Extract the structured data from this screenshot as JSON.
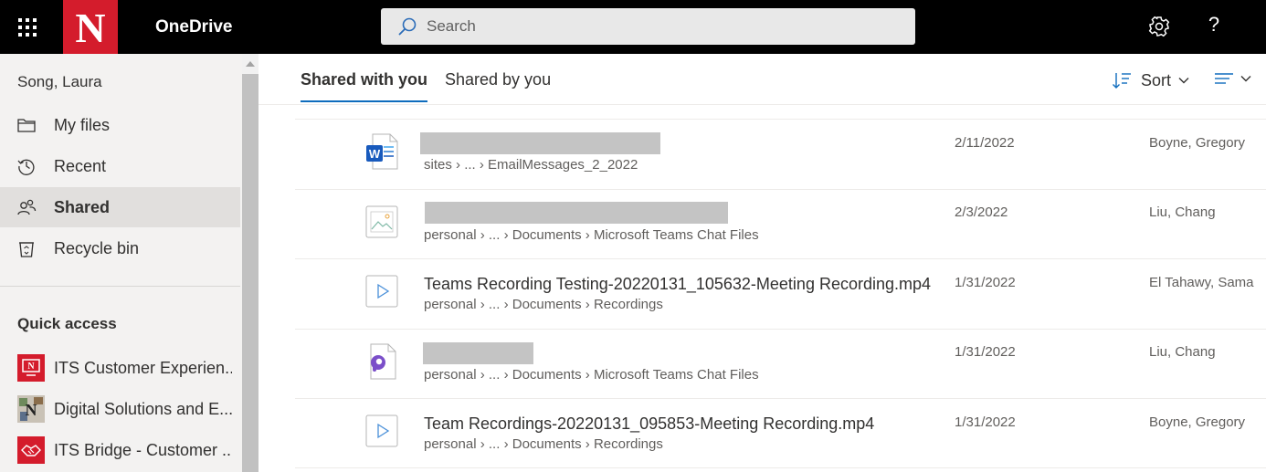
{
  "header": {
    "app_title": "OneDrive",
    "logo_letter": "N",
    "search_placeholder": "Search",
    "help_label": "?"
  },
  "sidebar": {
    "user_name": "Song, Laura",
    "items": [
      {
        "label": "My files",
        "icon": "folder-icon"
      },
      {
        "label": "Recent",
        "icon": "history-icon"
      },
      {
        "label": "Shared",
        "icon": "people-icon",
        "active": true
      },
      {
        "label": "Recycle bin",
        "icon": "recycle-bin-icon"
      }
    ],
    "quick_access_title": "Quick access",
    "quick_access": [
      {
        "label": "ITS Customer Experien..."
      },
      {
        "label": "Digital Solutions and E..."
      },
      {
        "label": "ITS Bridge - Customer ..."
      }
    ]
  },
  "main": {
    "tabs": [
      {
        "label": "Shared with you",
        "active": true
      },
      {
        "label": "Shared by you"
      }
    ],
    "sort_label": "Sort",
    "files": [
      {
        "name": "",
        "name_redacted": true,
        "type": "word-doc-icon",
        "path": [
          "sites",
          "...",
          "EmailMessages_2_2022"
        ],
        "date": "2/11/2022",
        "shared_by": "Boyne, Gregory"
      },
      {
        "name": "",
        "name_redacted": true,
        "type": "image-file-icon",
        "path": [
          "personal",
          "...",
          "Documents",
          "Microsoft Teams Chat Files"
        ],
        "date": "2/3/2022",
        "shared_by": "Liu, Chang"
      },
      {
        "name": "Teams Recording Testing-20220131_105632-Meeting Recording.mp4",
        "type": "video-file-icon",
        "path": [
          "personal",
          "...",
          "Documents",
          "Recordings"
        ],
        "date": "1/31/2022",
        "shared_by": "El Tahawy, Sama"
      },
      {
        "name": "",
        "name_redacted": true,
        "type": "sway-file-icon",
        "path": [
          "personal",
          "...",
          "Documents",
          "Microsoft Teams Chat Files"
        ],
        "date": "1/31/2022",
        "shared_by": "Liu, Chang"
      },
      {
        "name": "Team Recordings-20220131_095853-Meeting Recording.mp4",
        "type": "video-file-icon",
        "path": [
          "personal",
          "...",
          "Documents",
          "Recordings"
        ],
        "date": "1/31/2022",
        "shared_by": "Boyne, Gregory"
      }
    ]
  },
  "colors": {
    "topbar": "#000000",
    "brand_red": "#d41c2c",
    "accent_blue": "#0f6cbd",
    "sidebar_bg": "#f3f2f1"
  }
}
